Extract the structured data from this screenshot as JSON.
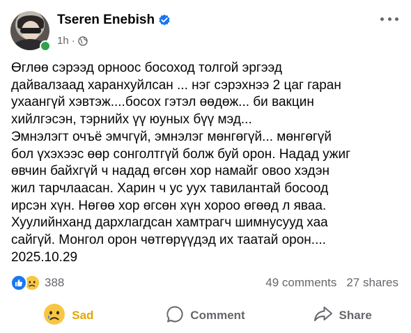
{
  "post": {
    "author": "Tseren Enebish",
    "time": "1h",
    "separator": "·",
    "text": "Өглөө сэрээд орноос босоход толгой эргээд\nдайвалзаад харанхуйлсан ... нэг сэрэхнээ 2 цаг гаран\nухаангүй хэвтэж....босох гэтэл өөдөж... би вакцин\nхийлгэсэн, тэрнийх үү юуных бүү мэд...\nЭмнэлэгт очъё эмчгүй, эмнэлэг мөнгөгүй... мөнгөгүй\nбол үхэхээс өөр сонголтгүй болж буй орон. Надад ужиг\nөвчин байхгүй ч надад өгсөн хор намайг овоо хэдэн\nжил тарчлаасан. Харин ч ус уух тавилантай босоод\nирсэн хүн. Нөгөө хор өгсөн хүн хороо өгөөд л яваа.\nХуулийнханд дархлагдсан хамтрагч шимнусууд хаа\nсайгүй. Монгол орон чөтгөрүүдэд их таатай орон....\n2025.10.29"
  },
  "stats": {
    "reaction_count": "388",
    "comments": "49 comments",
    "shares": "27 shares"
  },
  "actions": {
    "react_label": "Sad",
    "comment_label": "Comment",
    "share_label": "Share"
  },
  "colors": {
    "accent_blue": "#1877f2",
    "sad_yellow": "#e0a700",
    "secondary_text": "#65676b",
    "online_green": "#31a24c"
  },
  "icons": [
    "verified-badge-icon",
    "globe-icon",
    "more-options-icon",
    "like-reaction-icon",
    "sad-reaction-icon",
    "comment-icon",
    "share-icon"
  ]
}
